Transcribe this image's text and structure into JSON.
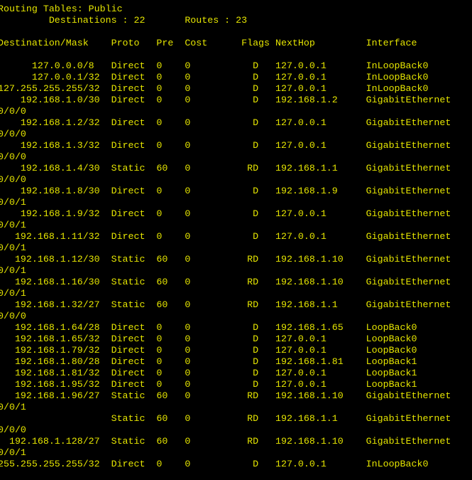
{
  "theme": {
    "background": "#000000",
    "foreground": "#e5e500"
  },
  "terminal": {
    "lines": [
      "Routing Tables: Public",
      "         Destinations : 22       Routes : 23",
      "",
      "Destination/Mask    Proto   Pre  Cost      Flags NextHop         Interface",
      "",
      "      127.0.0.0/8   Direct  0    0           D   127.0.0.1       InLoopBack0",
      "      127.0.0.1/32  Direct  0    0           D   127.0.0.1       InLoopBack0",
      "127.255.255.255/32  Direct  0    0           D   127.0.0.1       InLoopBack0",
      "    192.168.1.0/30  Direct  0    0           D   192.168.1.2     GigabitEthernet",
      "0/0/0",
      "    192.168.1.2/32  Direct  0    0           D   127.0.0.1       GigabitEthernet",
      "0/0/0",
      "    192.168.1.3/32  Direct  0    0           D   127.0.0.1       GigabitEthernet",
      "0/0/0",
      "    192.168.1.4/30  Static  60   0          RD   192.168.1.1     GigabitEthernet",
      "0/0/0",
      "    192.168.1.8/30  Direct  0    0           D   192.168.1.9     GigabitEthernet",
      "0/0/1",
      "    192.168.1.9/32  Direct  0    0           D   127.0.0.1       GigabitEthernet",
      "0/0/1",
      "   192.168.1.11/32  Direct  0    0           D   127.0.0.1       GigabitEthernet",
      "0/0/1",
      "   192.168.1.12/30  Static  60   0          RD   192.168.1.10    GigabitEthernet",
      "0/0/1",
      "   192.168.1.16/30  Static  60   0          RD   192.168.1.10    GigabitEthernet",
      "0/0/1",
      "   192.168.1.32/27  Static  60   0          RD   192.168.1.1     GigabitEthernet",
      "0/0/0",
      "   192.168.1.64/28  Direct  0    0           D   192.168.1.65    LoopBack0",
      "   192.168.1.65/32  Direct  0    0           D   127.0.0.1       LoopBack0",
      "   192.168.1.79/32  Direct  0    0           D   127.0.0.1       LoopBack0",
      "   192.168.1.80/28  Direct  0    0           D   192.168.1.81    LoopBack1",
      "   192.168.1.81/32  Direct  0    0           D   127.0.0.1       LoopBack1",
      "   192.168.1.95/32  Direct  0    0           D   127.0.0.1       LoopBack1",
      "   192.168.1.96/27  Static  60   0          RD   192.168.1.10    GigabitEthernet",
      "0/0/1",
      "                    Static  60   0          RD   192.168.1.1     GigabitEthernet",
      "0/0/0",
      "  192.168.1.128/27  Static  60   0          RD   192.168.1.10    GigabitEthernet",
      "0/0/1",
      "255.255.255.255/32  Direct  0    0           D   127.0.0.1       InLoopBack0"
    ]
  }
}
